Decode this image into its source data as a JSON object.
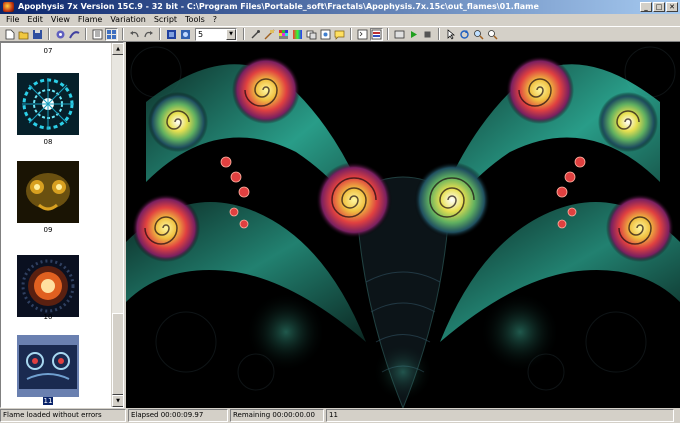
{
  "window": {
    "title": "Apophysis 7x Version 15C.9  - 32 bit - C:\\Program Files\\Portable_soft\\Fractals\\Apophysis.7x.15c\\out_flames\\01.flame",
    "minimize": "_",
    "maximize": "□",
    "close": "✕"
  },
  "menu": [
    "File",
    "Edit",
    "View",
    "Flame",
    "Variation",
    "Script",
    "Tools",
    "?"
  ],
  "toolbar": {
    "icons": [
      "new-icon",
      "open-icon",
      "save-icon",
      "batch-icon",
      "editor-icon",
      "list-view-icon",
      "icon-view-icon",
      "undo-icon",
      "redo-icon",
      "full-view-icon",
      "render-icon",
      "settings-icon",
      "scale-icon",
      "gradient-icon",
      "canvas-icon",
      "mutate-icon",
      "options-icon",
      "messages-icon",
      "script-editor-icon",
      "play-icon",
      "stop-icon",
      "select-icon",
      "rotate-icon",
      "zoom-in-icon",
      "zoom-out-icon"
    ],
    "combo_value": "5"
  },
  "thumbnails": [
    {
      "label": "07",
      "colors": [
        "#203a6a",
        "#4ab8e0",
        "#f0f0ff"
      ]
    },
    {
      "label": "08",
      "colors": [
        "#06405a",
        "#2cd0e8",
        "#ffffff"
      ]
    },
    {
      "label": "09",
      "colors": [
        "#3a2a08",
        "#d8a020",
        "#fff0a0"
      ]
    },
    {
      "label": "10",
      "colors": [
        "#10203a",
        "#e06020",
        "#ffe0a0"
      ]
    },
    {
      "label": "11",
      "colors": [
        "#5070a0",
        "#1a2a50",
        "#a8d8f0"
      ]
    }
  ],
  "status": {
    "message": "Flame loaded without errors",
    "elapsed": "Elapsed 00:00:09.97",
    "remaining": "Remaining 00:00:00.00",
    "flame_name": "11"
  },
  "colors": {
    "titlebar_start": "#0a246a",
    "titlebar_end": "#a6caf0",
    "spiral_warm": "#e04040",
    "spiral_yellow": "#e8e050",
    "spiral_teal": "#30b8a0",
    "background": "#000000"
  }
}
